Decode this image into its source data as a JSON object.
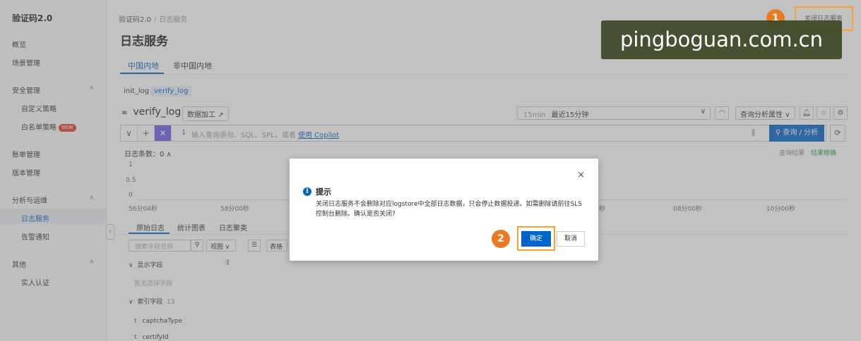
{
  "sidebar": {
    "app_title": "验证码2.0",
    "items": [
      {
        "label": "概览"
      },
      {
        "label": "场景管理"
      },
      {
        "label": "安全管理",
        "group": true
      },
      {
        "label": "自定义策略"
      },
      {
        "label": "白名单策略",
        "badge": "NEW"
      },
      {
        "label": "账单管理"
      },
      {
        "label": "版本管理"
      },
      {
        "label": "分析与运维",
        "group": true
      },
      {
        "label": "日志服务",
        "active": true
      },
      {
        "label": "告警通知"
      },
      {
        "label": "其他",
        "group": true
      },
      {
        "label": "实人认证"
      }
    ]
  },
  "breadcrumb": {
    "root": "验证码2.0",
    "sep": "/",
    "current": "日志服务"
  },
  "page_title": "日志服务",
  "region_tabs": [
    "中国内地",
    "非中国内地"
  ],
  "logstores": [
    "init_log",
    "verify_log"
  ],
  "logstore": {
    "icon": "≡",
    "name": "verify_log",
    "process_button": "数据加工",
    "process_icon": "↗"
  },
  "time_range": {
    "short": "15min",
    "label": "最近15分钟",
    "chevron": "∨"
  },
  "analysis_props": "查询分析属性",
  "toolbar_glyphs": {
    "gauge": "◠",
    "bell": "🔔︎",
    "star": "☆",
    "gear": "⚙︎",
    "refresh": "⟳"
  },
  "query": {
    "collapse": "∨",
    "add": "+",
    "copilot_icon": "✕",
    "line_no": "1",
    "placeholder": "输入查询语句、SQL、SPL，或者",
    "copilot_link": "使用 Copilot",
    "sliders": "⫼",
    "submit": "查询 / 分析",
    "search_glyph": "⚲"
  },
  "log_count": {
    "label": "日志条数：",
    "value": "0",
    "chevron": "∧"
  },
  "query_status": {
    "left": "查询结果",
    "right": "结果精确"
  },
  "histogram": {
    "y_ticks": [
      "1",
      "0.5",
      "0"
    ],
    "x_ticks": [
      "56分04秒",
      "58分00秒",
      "08分00秒",
      "10分00秒"
    ],
    "x_partial": "秒"
  },
  "result_tabs": [
    "原始日志",
    "统计图表",
    "日志聚类"
  ],
  "field_search": {
    "placeholder": "搜索字段名称",
    "icon": "⚲"
  },
  "view_select": {
    "label": "视图",
    "chevron": "∨"
  },
  "table_button": "表格",
  "shown_fields": {
    "header": "显示字段",
    "empty": "暂无选择字段"
  },
  "index_fields": {
    "header": "索引字段",
    "count": "13",
    "items": [
      "captchaType",
      "certifyId"
    ],
    "type_marker": "t"
  },
  "annotation": {
    "step1": "1",
    "step2": "2",
    "close_service": "关闭日志服务"
  },
  "watermark": "pingboguan.com.cn",
  "dialog": {
    "icon": "i",
    "title": "提示",
    "body": "关闭日志服务不会删除对应logstore中全部日志数据，只会停止数据投递。如需删除请前往SLS控制台删除。确认是否关闭?",
    "ok": "确定",
    "cancel": "取消",
    "close": "×"
  },
  "colors": {
    "primary": "#0064c8",
    "accent_orange": "#ec7a25",
    "highlight_border": "#f5a336",
    "copilot_purple": "#6c5ce7",
    "badge_red": "#e4392f"
  }
}
